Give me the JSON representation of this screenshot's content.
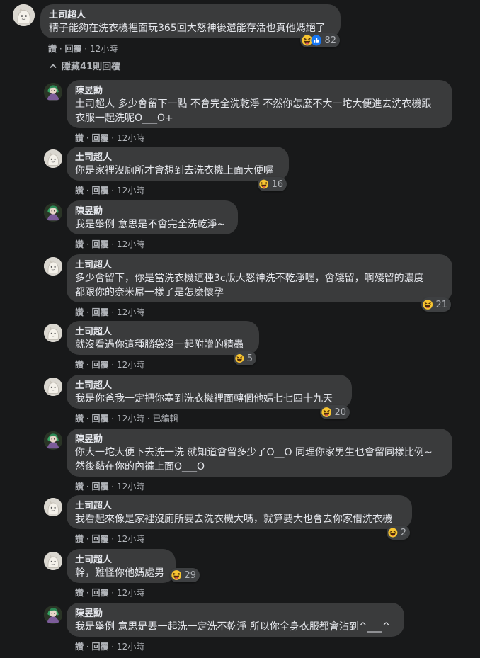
{
  "top_comment": {
    "author": "土司超人",
    "text": "精子能夠在洗衣機裡面玩365回大怒神後還能存活也真他媽絕了",
    "reaction_count": "82",
    "like": "讚",
    "reply": "回覆",
    "time": "12小時"
  },
  "hidden_replies": {
    "icon": "chevron-up-icon",
    "label": "隱藏41則回覆"
  },
  "replies": [
    {
      "author": "陳昱勳",
      "lines": [
        "土司超人 多少會留下一點 不會完全洗乾淨 不然你怎麼不大一坨大便進去洗衣機跟",
        "衣服一起洗呢O___O+"
      ],
      "like": "讚",
      "reply": "回覆",
      "time": "12小時",
      "reaction_count": null,
      "edited": null
    },
    {
      "author": "土司超人",
      "lines": [
        "你是家裡沒廁所才會想到去洗衣機上面大便喔"
      ],
      "like": "讚",
      "reply": "回覆",
      "time": "12小時",
      "reaction_count": "16",
      "edited": null
    },
    {
      "author": "陳昱勳",
      "lines": [
        "我是舉例 意思是不會完全洗乾淨~"
      ],
      "like": "讚",
      "reply": "回覆",
      "time": "12小時",
      "reaction_count": null,
      "edited": null
    },
    {
      "author": "土司超人",
      "lines": [
        "多少會留下，你是當洗衣機這種3c版大怒神洗不乾淨喔，會殘留，啊殘留的濃度",
        "都跟你的奈米屌一樣了是怎麼懷孕"
      ],
      "like": "讚",
      "reply": "回覆",
      "time": "12小時",
      "reaction_count": "21",
      "edited": null
    },
    {
      "author": "土司超人",
      "lines": [
        "就沒看過你這種腦袋沒一起附贈的精蟲"
      ],
      "like": "讚",
      "reply": "回覆",
      "time": "12小時",
      "reaction_count": "5",
      "edited": null
    },
    {
      "author": "土司超人",
      "lines": [
        "我是你爸我一定把你塞到洗衣機裡面轉個他媽七七四十九天"
      ],
      "like": "讚",
      "reply": "回覆",
      "time": "12小時",
      "reaction_count": "20",
      "edited": "已編輯"
    },
    {
      "author": "陳昱勳",
      "lines": [
        "你大一坨大便下去洗一洗 就知道會留多少了O__O 同理你家男生也會留同樣比例~",
        "然後黏在你的內褲上面O___O"
      ],
      "like": "讚",
      "reply": "回覆",
      "time": "12小時",
      "reaction_count": null,
      "edited": null
    },
    {
      "author": "土司超人",
      "lines": [
        "我看起來像是家裡沒廁所要去洗衣機大嗎，就算要大也會去你家借洗衣機"
      ],
      "like": "讚",
      "reply": "回覆",
      "time": "12小時",
      "reaction_count": "2",
      "edited": null
    },
    {
      "author": "土司超人",
      "lines": [
        "幹，難怪你他媽處男"
      ],
      "like": "讚",
      "reply": "回覆",
      "time": "12小時",
      "reaction_count": "29",
      "edited": null
    },
    {
      "author": "陳昱勳",
      "lines": [
        "我是舉例 意思是丟一起洗一定洗不乾淨 所以你全身衣服都會沾到^___^"
      ],
      "like": "讚",
      "reply": "回覆",
      "time": "12小時",
      "reaction_count": null,
      "edited": null
    }
  ],
  "colors": {
    "background": "#18191a",
    "bubble": "#3a3b3c",
    "text": "#e4e6eb",
    "secondary_text": "#b0b3b8",
    "emoji_yellow": "#f7c531",
    "like_blue": "#1877f2"
  }
}
